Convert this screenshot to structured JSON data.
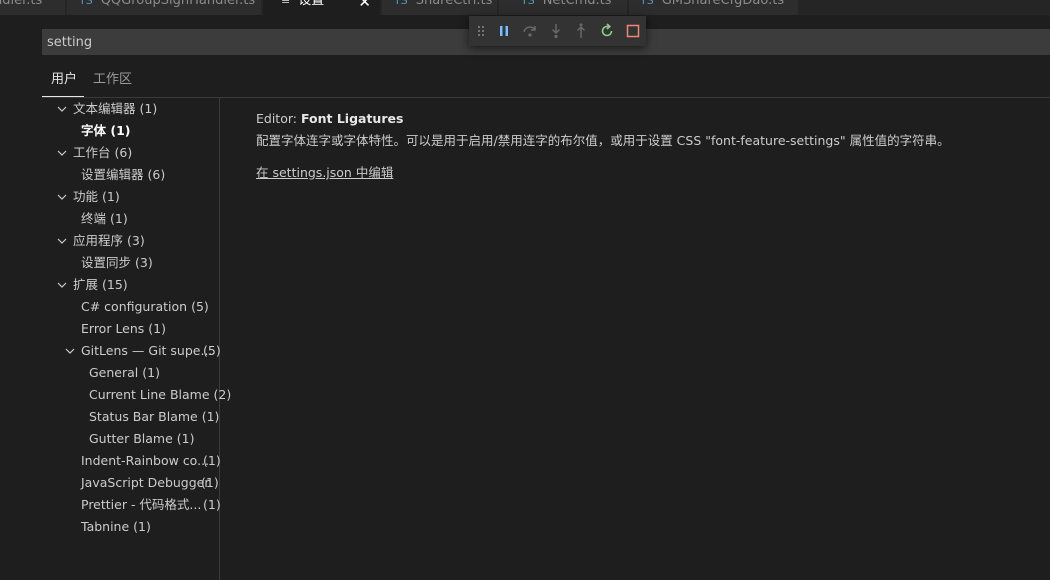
{
  "tabs": [
    {
      "label": "ndler.ts",
      "icon": "ts-file-icon",
      "active": false
    },
    {
      "label": "QQGroupSignHandler.ts",
      "icon": "ts-file-icon",
      "active": false
    },
    {
      "label": "设置",
      "icon": "settings-file-icon",
      "active": true
    },
    {
      "label": "ShareCtrl.ts",
      "icon": "ts-file-icon",
      "active": false
    },
    {
      "label": "NetCmd.ts",
      "icon": "ts-file-icon",
      "active": false
    },
    {
      "label": "GMShareCfgDao.ts",
      "icon": "ts-file-icon",
      "active": false
    }
  ],
  "ts_badge": "TS",
  "search": {
    "value": "setting"
  },
  "debug_toolbar": {
    "buttons": [
      "grip-icon",
      "pause-icon",
      "step-over-icon",
      "step-into-icon",
      "step-out-icon",
      "restart-icon",
      "stop-icon"
    ],
    "colors": {
      "pause": "#75beff",
      "restart": "#89d185",
      "stop": "#f48771",
      "disabled": "#6b6b6b"
    }
  },
  "scope_tabs": [
    {
      "label": "用户",
      "active": true
    },
    {
      "label": "工作区",
      "active": false
    }
  ],
  "toc": {
    "items": [
      {
        "label": "文本编辑器",
        "count": "(1)",
        "expanded": true
      },
      {
        "label": "字体",
        "count": "(1)",
        "active": true
      },
      {
        "label": "工作台",
        "count": "(6)",
        "expanded": true
      },
      {
        "label": "设置编辑器",
        "count": "(6)"
      },
      {
        "label": "功能",
        "count": "(1)",
        "expanded": true
      },
      {
        "label": "终端",
        "count": "(1)"
      },
      {
        "label": "应用程序",
        "count": "(3)",
        "expanded": true
      },
      {
        "label": "设置同步",
        "count": "(3)"
      },
      {
        "label": "扩展",
        "count": "(15)",
        "expanded": true
      },
      {
        "label": "C# configuration",
        "count": "(5)"
      },
      {
        "label": "Error Lens",
        "count": "(1)"
      },
      {
        "label": "GitLens — Git supe...",
        "count": "(5)",
        "expanded": true
      },
      {
        "label": "General",
        "count": "(1)"
      },
      {
        "label": "Current Line Blame",
        "count": "(2)"
      },
      {
        "label": "Status Bar Blame",
        "count": "(1)"
      },
      {
        "label": "Gutter Blame",
        "count": "(1)"
      },
      {
        "label": "Indent-Rainbow co...",
        "count": "(1)"
      },
      {
        "label": "JavaScript Debugger",
        "count": "(1)"
      },
      {
        "label": "Prettier - 代码格式...",
        "count": "(1)"
      },
      {
        "label": "Tabnine",
        "count": "(1)"
      }
    ]
  },
  "setting": {
    "category": "Editor: ",
    "name": "Font Ligatures",
    "description": "配置字体连字或字体特性。可以是用于启用/禁用连字的布尔值，或用于设置 CSS \"font-feature-settings\" 属性值的字符串。",
    "link": "在 settings.json 中编辑"
  }
}
